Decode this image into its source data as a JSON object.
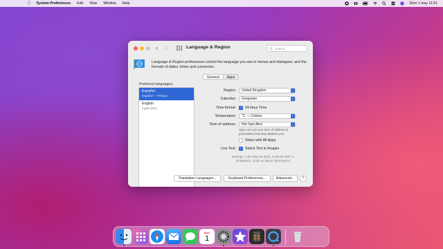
{
  "menubar": {
    "app_name": "System Preferences",
    "menus": [
      "Edit",
      "View",
      "Window",
      "Help"
    ],
    "clock": "Dom 1 may  11:51"
  },
  "window": {
    "title": "Language & Region",
    "search_placeholder": "Search",
    "description": "Language & Region preferences control the language you see in menus and dialogues, and the formats of dates, times and currencies.",
    "tabs": [
      {
        "label": "General",
        "selected": true
      },
      {
        "label": "Apps",
        "selected": false
      }
    ],
    "preferred_languages_label": "Preferred languages:",
    "languages": [
      {
        "name": "Español",
        "sub": "Español — Primary",
        "active": true
      },
      {
        "name": "English",
        "sub": "Inglés (RU)",
        "active": false
      }
    ],
    "list_footer": {
      "add": "+",
      "remove": "−",
      "gear": "⚙ ▾"
    },
    "region": {
      "label": "Region:",
      "value": "United Kingdom"
    },
    "calendar": {
      "label": "Calendar:",
      "value": "Gregorian"
    },
    "time_format": {
      "label": "Time format:",
      "value": "24-Hour Time",
      "checked": true
    },
    "temperature": {
      "label": "Temperature:",
      "value": "°C — Celsius"
    },
    "term_of_address": {
      "label": "Term of address:",
      "value": "Not Specified"
    },
    "term_note": "Apps can use your term of address to personalise how they address you.",
    "share_all_apps": {
      "label": "Share with All Apps",
      "checked": false
    },
    "live_text": {
      "label": "Live Text:",
      "value": "Select Text in Images",
      "checked": true
    },
    "samples": [
      "domingo, 1 de mayo de 2022, 11:50:29 GMT+1",
      "01/05/2022, 11:50   12.345,67   45.678,90 £"
    ],
    "buttons": {
      "translation": "Translation Languages...",
      "keyboard": "Keyboard Preferences...",
      "advanced": "Advanced...",
      "help": "?"
    }
  },
  "dock": {
    "calendar_month": "MAY",
    "calendar_day": "1"
  },
  "colors": {
    "accent": "#2f67d6",
    "close": "#fe5f57",
    "minimize": "#febc2e"
  }
}
